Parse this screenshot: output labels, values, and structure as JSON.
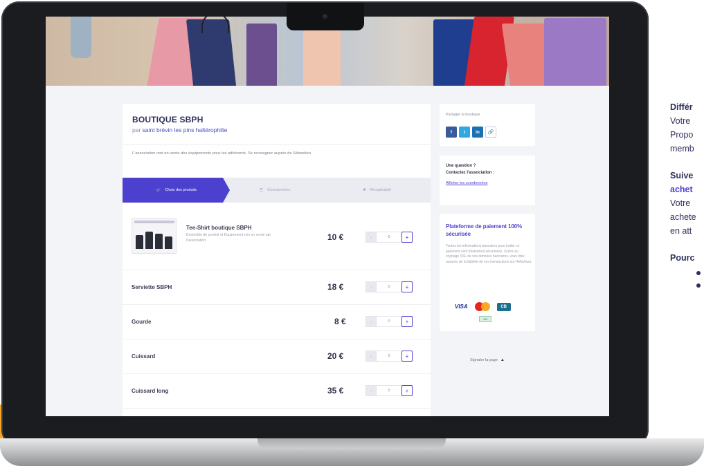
{
  "shop": {
    "title": "BOUTIQUE SBPH",
    "by": "par",
    "org": "saint brévin les pins haltérophilie",
    "description": "L'association met en vente des équipements pour les adhérents. Se renseigner auprès de Sébastien"
  },
  "tabs": [
    {
      "label": "Choix des produits",
      "icon": "cart-icon",
      "active": true
    },
    {
      "label": "Coordonnées",
      "icon": "list-icon",
      "active": false
    },
    {
      "label": "Récapitulatif",
      "icon": "summary-icon",
      "active": false
    }
  ],
  "products": [
    {
      "name": "Tee-Shirt boutique SBPH",
      "subtitle": "Ensemble de produit et Équipement mis en vente par l'association",
      "price": "10 €",
      "quantity": "0"
    },
    {
      "name": "Serviette SBPH",
      "price": "18 €",
      "quantity": "0"
    },
    {
      "name": "Gourde",
      "price": "8 €",
      "quantity": "0"
    },
    {
      "name": "Cuissard",
      "price": "20 €",
      "quantity": "0"
    },
    {
      "name": "Cuissard long",
      "price": "35 €",
      "quantity": "0"
    }
  ],
  "stepper": {
    "minus": "-",
    "plus": "+"
  },
  "share": {
    "label": "Partager la boutique",
    "buttons": [
      {
        "name": "facebook-icon",
        "glyph": "f"
      },
      {
        "name": "twitter-icon",
        "glyph": "t"
      },
      {
        "name": "linkedin-icon",
        "glyph": "in"
      },
      {
        "name": "link-icon",
        "glyph": "🔗"
      }
    ]
  },
  "question": {
    "title": "Une question ?",
    "contact": "Contactez l'association :",
    "link": "Afficher les coordonnées"
  },
  "payment": {
    "title": "Plateforme de paiement 100% sécurisée",
    "body": "Toutes les informations bancaires pour traiter ce paiement sont totalement sécurisées. Grâce au cryptage SSL de vos données bancaires, vous êtes assurés de la fiabilité de vos transactions sur HelloAsso.",
    "logos": {
      "visa": "VISA",
      "cb": "CB",
      "other": "CB"
    }
  },
  "report": {
    "label": "Signaler la page",
    "icon": "warning-icon"
  },
  "side_text": {
    "line1": "Différ",
    "line2": "Votre",
    "line3": "Propo",
    "line4": "memb",
    "line5": "Suive",
    "line6": "achet",
    "line7": "Votre",
    "line8": "achete",
    "line9": "en att",
    "line10": "Pourc"
  },
  "colors": {
    "accent": "#4c40cf",
    "title": "#2e2f5c",
    "facebook": "#3b5a9a",
    "twitter": "#32a7e4",
    "linkedin": "#1c72b1"
  }
}
